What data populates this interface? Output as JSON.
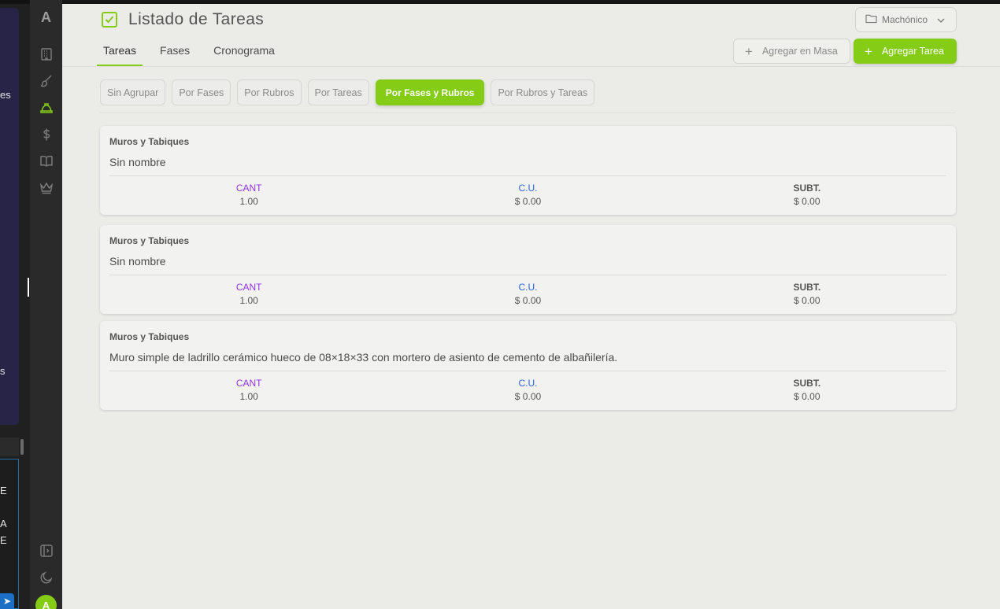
{
  "left_strip": {
    "fragments": [
      "es",
      "s",
      "E",
      "A",
      "E"
    ]
  },
  "sidebar": {
    "logo": "A",
    "icons": [
      "building-icon",
      "brush-icon",
      "hardhat-icon",
      "dollar-icon",
      "book-icon",
      "crown-icon",
      "panel-icon",
      "moon-icon"
    ],
    "avatar": "A"
  },
  "header": {
    "title": "Listado de Tareas",
    "project": "Machónico",
    "tabs": [
      {
        "label": "Tareas",
        "active": true
      },
      {
        "label": "Fases",
        "active": false
      },
      {
        "label": "Cronograma",
        "active": false
      }
    ],
    "bulk_add_label": "Agregar en Masa",
    "add_task_label": "Agregar Tarea"
  },
  "groupings": [
    {
      "label": "Sin Agrupar",
      "active": false
    },
    {
      "label": "Por Fases",
      "active": false
    },
    {
      "label": "Por Rubros",
      "active": false
    },
    {
      "label": "Por Tareas",
      "active": false
    },
    {
      "label": "Por Fases y Rubros",
      "active": true
    },
    {
      "label": "Por Rubros y Tareas",
      "active": false
    }
  ],
  "stat_labels": {
    "cant": "CANT",
    "cu": "C.U.",
    "subt": "SUBT."
  },
  "tasks": [
    {
      "category": "Muros y Tabiques",
      "name": "Sin nombre",
      "cant": "1.00",
      "cu": "$ 0.00",
      "subt": "$ 0.00"
    },
    {
      "category": "Muros y Tabiques",
      "name": "Sin nombre",
      "cant": "1.00",
      "cu": "$ 0.00",
      "subt": "$ 0.00"
    },
    {
      "category": "Muros y Tabiques",
      "name": "Muro simple de ladrillo cerámico hueco de 08×18×33 con mortero de asiento de cemento de albañilería.",
      "cant": "1.00",
      "cu": "$ 0.00",
      "subt": "$ 0.00"
    }
  ],
  "colors": {
    "accent": "#84cc16",
    "cant": "#9333ea",
    "cu": "#2563eb"
  }
}
